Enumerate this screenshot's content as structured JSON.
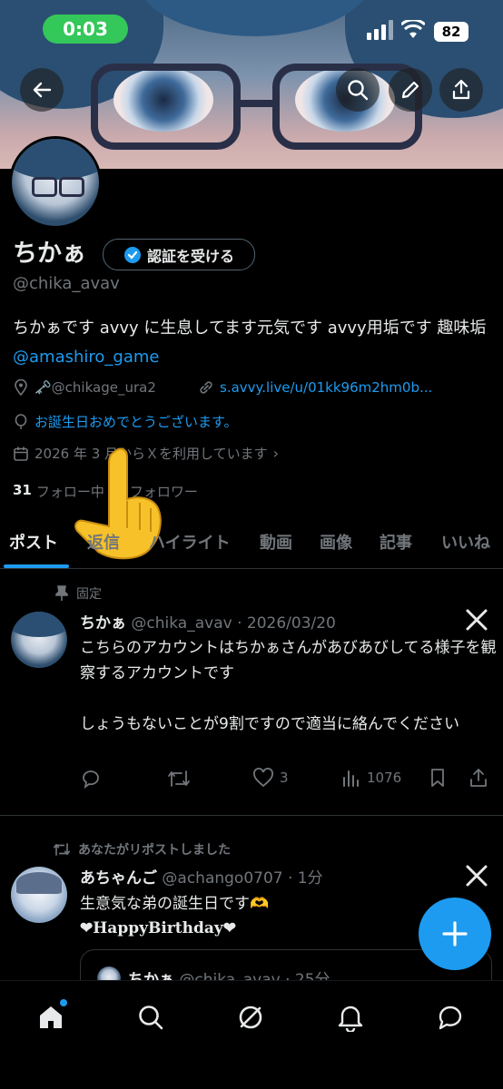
{
  "status_bar": {
    "time": "0:03",
    "battery": "82"
  },
  "profile": {
    "display_name": "ちかぁ",
    "verify_label": "認証を受ける",
    "handle": "@chika_avav",
    "bio_text": "ちかぁです avvy に生息してます元気です avvy用垢です 趣味垢 ",
    "bio_mention": "@amashiro_game",
    "location": "🗝️@chikage_ura2",
    "link": "s.avvy.live/u/01kk96m2hm0b...",
    "birthday": "お誕生日おめでとうございます。",
    "joined": "2026 年 3 月からＸを利用しています",
    "following_count": "31",
    "following_label": "フォロー中",
    "followers_label": "フォロワー"
  },
  "tabs": [
    "ポスト",
    "返信",
    "ハイライト",
    "動画",
    "画像",
    "記事",
    "いいね"
  ],
  "pinned_label": "固定",
  "tweet1": {
    "name": "ちかぁ",
    "handle_date": "@chika_avav · 2026/03/20",
    "text": "こちらのアカウントはちかぁさんがあびあびしてる様子を観察するアカウントです\n\nしょうもないことが9割ですので適当に絡んでください",
    "likes": "3",
    "views": "1076"
  },
  "repost_label": "あなたがリポストしました",
  "tweet2": {
    "name": "あちゃんご",
    "handle_date": "@achango0707 · 1分",
    "line1": "生意気な弟の誕生日です🫶",
    "line2": "❤HappyBirthday❤",
    "quote_name": "ちかぁ",
    "quote_handle": "@chika_avav · 25分"
  },
  "colors": {
    "accent": "#1d9bf0",
    "background": "#000000",
    "text": "#e7e9ea",
    "muted": "#71767b"
  }
}
